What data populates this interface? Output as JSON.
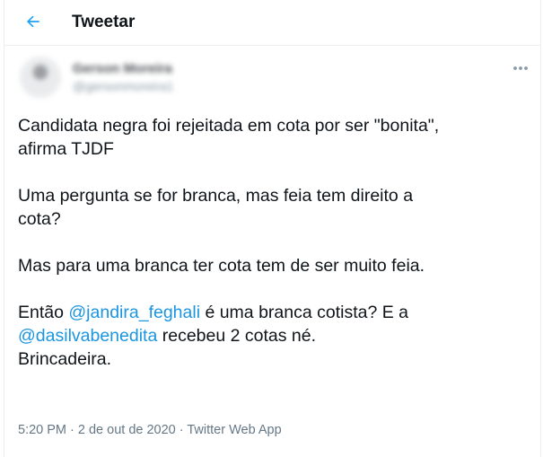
{
  "header": {
    "title": "Tweetar",
    "back_icon": "arrow-left-icon"
  },
  "colors": {
    "accent": "#1da1f2",
    "mention": "#1b95e0",
    "text": "#0f1419",
    "muted": "#657786",
    "border": "#ebeef0"
  },
  "author": {
    "name": "Gerson Moreira",
    "handle": "@gersonmoreira1"
  },
  "tweet": {
    "line1": "Candidata negra foi rejeitada em cota por ser \"bonita\",",
    "line2": "afirma TJDF",
    "line3": "Uma pergunta se for branca, mas feia tem direito a",
    "line4": "cota?",
    "line5": "Mas para uma branca ter cota tem de ser muito feia.",
    "line6_pre": "Então ",
    "mention1": "@jandira_feghali",
    "line6_post": " é uma branca cotista? E a",
    "mention2": "@dasilvabenedita",
    "line7_post": " recebeu 2 cotas né.",
    "line8": "Brincadeira."
  },
  "meta": {
    "time": "5:20 PM",
    "sep1": " · ",
    "date": "2 de out de 2020",
    "sep2": " · ",
    "source": "Twitter Web App"
  }
}
